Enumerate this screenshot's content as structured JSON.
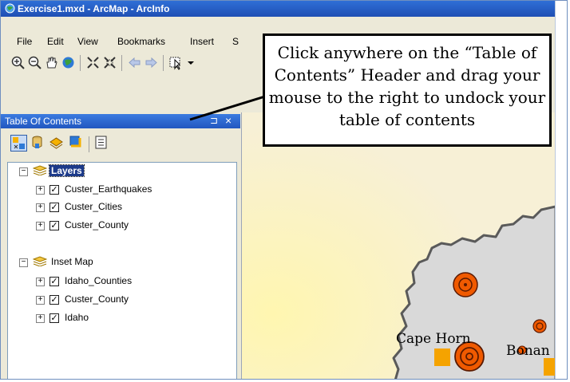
{
  "window": {
    "title": "Exercise1.mxd - ArcMap - ArcInfo"
  },
  "menu": {
    "items": [
      {
        "label": "File"
      },
      {
        "label": "Edit"
      },
      {
        "label": "View"
      },
      {
        "label": "Bookmarks"
      },
      {
        "label": "Insert"
      },
      {
        "label": "S"
      }
    ]
  },
  "toc": {
    "title": "Table Of Contents",
    "pin_glyph": "⊐",
    "close_glyph": "×",
    "groups": [
      {
        "label": "Layers",
        "expand_glyph": "⊟",
        "layers": [
          {
            "label": "Custer_Earthquakes",
            "checked": true
          },
          {
            "label": "Custer_Cities",
            "checked": true
          },
          {
            "label": "Custer_County",
            "checked": true
          }
        ]
      },
      {
        "label": "Inset Map",
        "expand_glyph": "⊟",
        "layers": [
          {
            "label": "Idaho_Counties",
            "checked": true
          },
          {
            "label": "Custer_County",
            "checked": true
          },
          {
            "label": "Idaho",
            "checked": true
          }
        ]
      }
    ]
  },
  "callout": {
    "text": "Click anywhere on the “Table of Contents” Header and drag your mouse to the right to undock your table of contents"
  },
  "map": {
    "labels": [
      {
        "text": "Cape Horn"
      },
      {
        "text": "Bonan"
      }
    ]
  },
  "icons": {
    "app": "globe-icon",
    "expand": "plus-box-icon",
    "check": "check-icon"
  },
  "colors": {
    "titlebar": "#2257c0",
    "map_background": "#f5edc8",
    "county_fill": "#d9d9d9",
    "earthquake": "#f05a00",
    "city": "#f5a300"
  }
}
